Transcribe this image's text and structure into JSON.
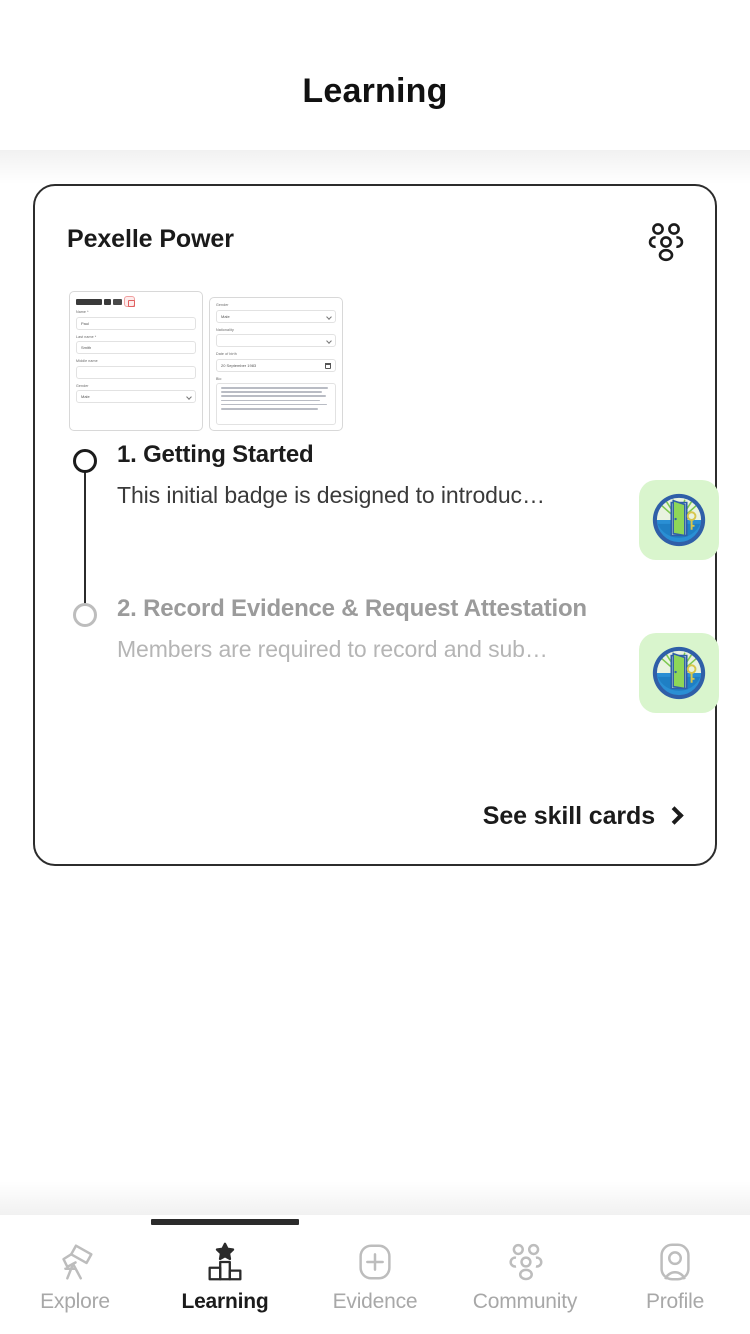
{
  "header": {
    "title": "Learning"
  },
  "card": {
    "title": "Pexelle Power",
    "community_icon": "community-icon",
    "thumbnails": [
      {
        "name": "profile-form-thumbnail-1",
        "fields": [
          {
            "label": "Name *",
            "value": "Paul"
          },
          {
            "label": "Last name *",
            "value": "Smith"
          },
          {
            "label": "Middle name",
            "value": ""
          },
          {
            "label": "Gender",
            "value": "Male"
          }
        ]
      },
      {
        "name": "profile-form-thumbnail-2",
        "fields": [
          {
            "label": "Gender",
            "value": "Male"
          },
          {
            "label": "Nationality",
            "value": ""
          },
          {
            "label": "Date of birth",
            "value": "20 September 1983"
          },
          {
            "label": "Bio",
            "value": ""
          }
        ]
      }
    ],
    "steps": [
      {
        "number": "1.",
        "title": "1. Getting Started",
        "description": "This initial badge is designed to introduc…",
        "state": "active",
        "badge_icon": "open-door-badge-icon"
      },
      {
        "number": "2.",
        "title": "2. Record Evidence & Request Attestation",
        "description": "Members are required to record and sub…",
        "state": "inactive",
        "badge_icon": "open-door-badge-icon"
      }
    ],
    "see_skill_cards_label": "See skill cards"
  },
  "bottom_nav": {
    "active_index": 1,
    "items": [
      {
        "label": "Explore",
        "icon": "telescope-icon"
      },
      {
        "label": "Learning",
        "icon": "podium-star-icon"
      },
      {
        "label": "Evidence",
        "icon": "plus-square-icon"
      },
      {
        "label": "Community",
        "icon": "community-icon"
      },
      {
        "label": "Profile",
        "icon": "person-square-icon"
      }
    ]
  },
  "colors": {
    "card_border": "#2c2c2c",
    "badge_tile_bg": "#d9f5cd",
    "active_text": "#1b1b1b",
    "inactive_text": "#b5b5b5",
    "nav_inactive": "#a8a8a8"
  }
}
